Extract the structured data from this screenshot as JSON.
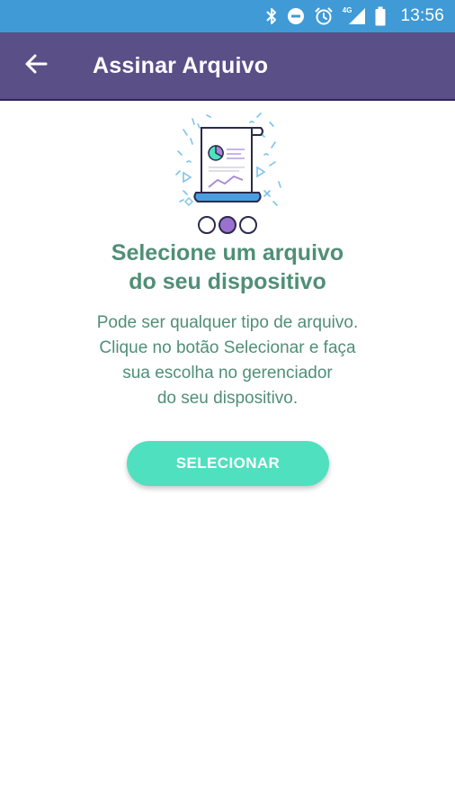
{
  "status_bar": {
    "network_label": "4G",
    "time": "13:56",
    "background_color": "#3f9ad6",
    "icons": [
      "bluetooth-icon",
      "do-not-disturb-icon",
      "alarm-icon",
      "signal-icon",
      "battery-icon"
    ]
  },
  "app_bar": {
    "title": "Assinar Arquivo",
    "back_icon": "arrow-left-icon",
    "background_color": "#5a4f87"
  },
  "content": {
    "illustration_icon": "document-chart-icon",
    "pager_dots": 3,
    "active_dot": 2,
    "headline": [
      "Selecione um arquivo",
      "do seu dispositivo"
    ],
    "description": [
      "Pode ser qualquer tipo de arquivo.",
      "Clique no botão Selecionar e faça",
      "sua escolha no gerenciador",
      "do seu dispositivo."
    ],
    "text_color": "#4f8f77"
  },
  "select_button": {
    "label": "SELECIONAR",
    "color": "#4fe0bf"
  }
}
